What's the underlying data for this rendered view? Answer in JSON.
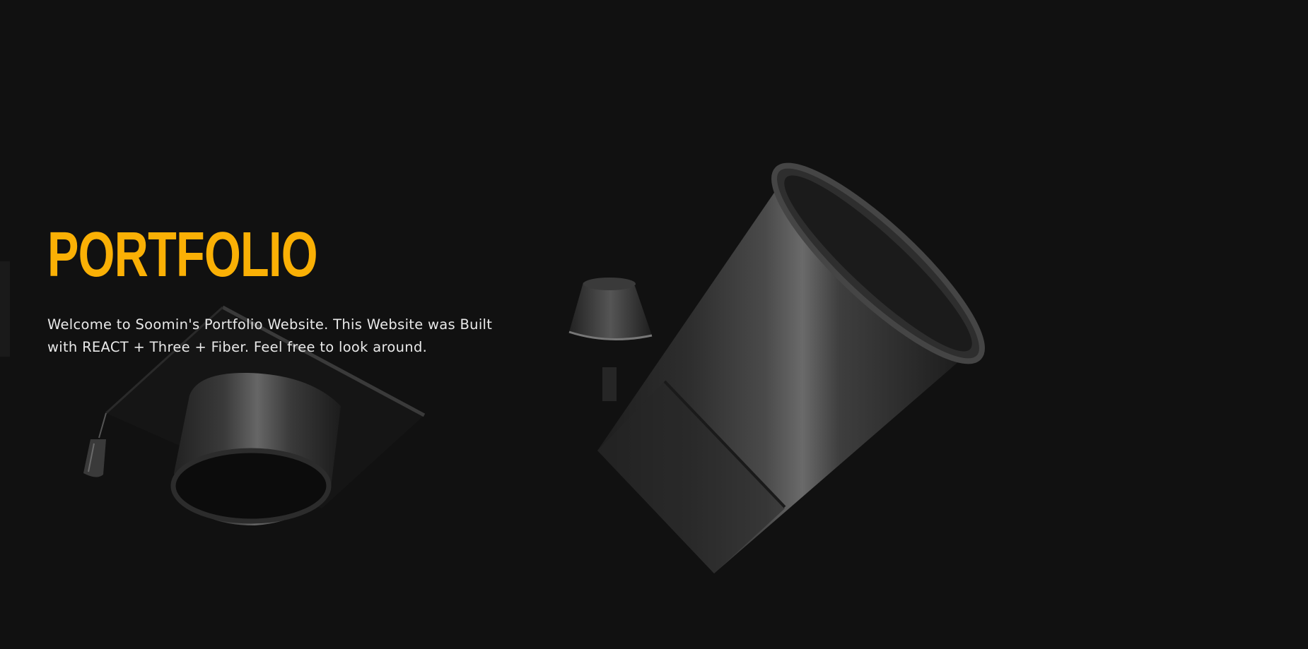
{
  "theme": {
    "background": "#111111",
    "accent": "#FAB005",
    "text": "#E9E9E9"
  },
  "hero": {
    "title": "PORTFOLIO",
    "description": "Welcome to Soomin's Portfolio Website. This Website was Built with REACT + Three + Fiber. Feel free to look around."
  },
  "scene": {
    "objects": [
      "graduation-cap-model",
      "tassel-model",
      "coffee-cup-model",
      "small-cup-model"
    ]
  }
}
